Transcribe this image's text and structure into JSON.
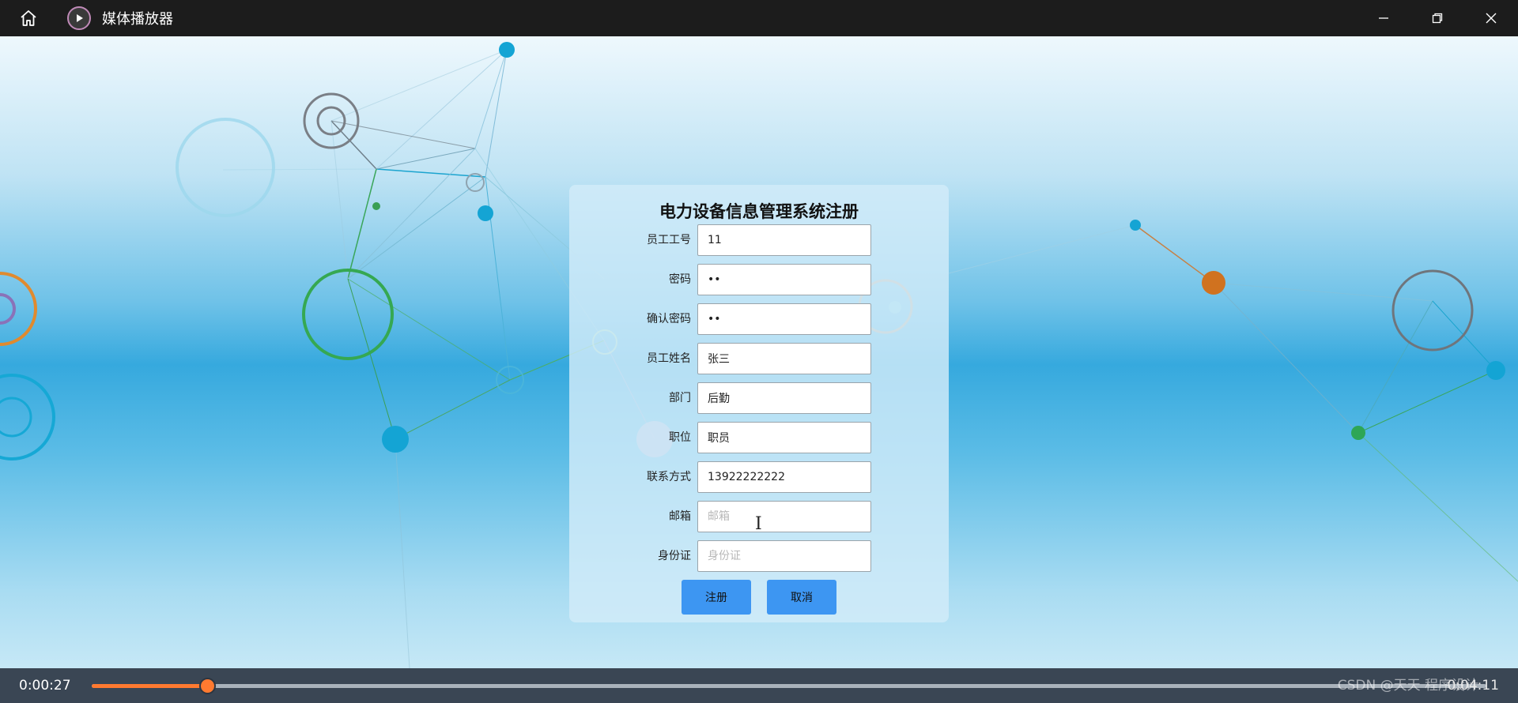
{
  "window": {
    "title": "媒体播放器",
    "icons": {
      "home": "home-icon",
      "app": "play-circle-icon",
      "minimize": "minimize-icon",
      "restore": "restore-icon",
      "close": "close-icon"
    }
  },
  "form": {
    "title": "电力设备信息管理系统注册",
    "fields": [
      {
        "label": "员工工号",
        "value": "11",
        "placeholder": "",
        "type": "text"
      },
      {
        "label": "密码",
        "value": "••",
        "placeholder": "",
        "type": "text"
      },
      {
        "label": "确认密码",
        "value": "••",
        "placeholder": "",
        "type": "text"
      },
      {
        "label": "员工姓名",
        "value": "张三",
        "placeholder": "",
        "type": "text"
      },
      {
        "label": "部门",
        "value": "后勤",
        "placeholder": "",
        "type": "text"
      },
      {
        "label": "职位",
        "value": "职员",
        "placeholder": "",
        "type": "text"
      },
      {
        "label": "联系方式",
        "value": "13922222222",
        "placeholder": "",
        "type": "text"
      },
      {
        "label": "邮箱",
        "value": "",
        "placeholder": "邮箱",
        "type": "text"
      },
      {
        "label": "身份证",
        "value": "",
        "placeholder": "身份证",
        "type": "text"
      }
    ],
    "register_label": "注册",
    "cancel_label": "取消"
  },
  "player": {
    "current_time": "0:00:27",
    "total_time": "0:04:11",
    "progress_percent": 8.3,
    "watermark": "CSDN @天天 程序设计"
  },
  "colors": {
    "accent": "#ff7a30",
    "button": "#3d96f2",
    "titlebar": "#1c1c1c",
    "controlbar": "#3a4654"
  }
}
